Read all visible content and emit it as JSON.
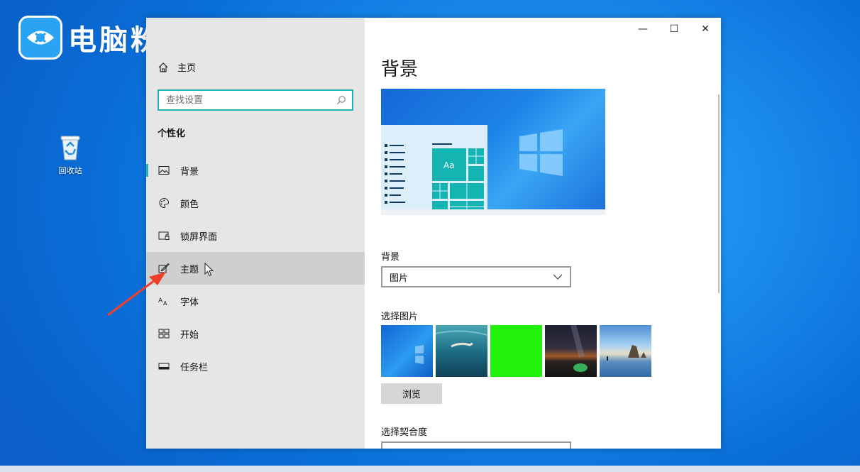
{
  "watermark": {
    "text": "电脑粉"
  },
  "desktop": {
    "recycle_bin_label": "回收站"
  },
  "window": {
    "controls": {
      "minimize": "—",
      "maximize": "☐",
      "close": "✕"
    },
    "sidebar": {
      "home_label": "主页",
      "search_placeholder": "查找设置",
      "section_title": "个性化",
      "items": [
        {
          "label": "背景",
          "icon": "picture-icon",
          "active": true
        },
        {
          "label": "颜色",
          "icon": "palette-icon"
        },
        {
          "label": "锁屏界面",
          "icon": "lock-screen-icon"
        },
        {
          "label": "主题",
          "icon": "theme-brush-icon",
          "hover": true
        },
        {
          "label": "字体",
          "icon": "font-icon"
        },
        {
          "label": "开始",
          "icon": "start-grid-icon"
        },
        {
          "label": "任务栏",
          "icon": "taskbar-icon"
        }
      ]
    },
    "main": {
      "title": "背景",
      "preview_sample_text": "Aa",
      "background_label": "背景",
      "background_value": "图片",
      "choose_picture_label": "选择图片",
      "browse_label": "浏览",
      "fit_label": "选择契合度"
    }
  }
}
